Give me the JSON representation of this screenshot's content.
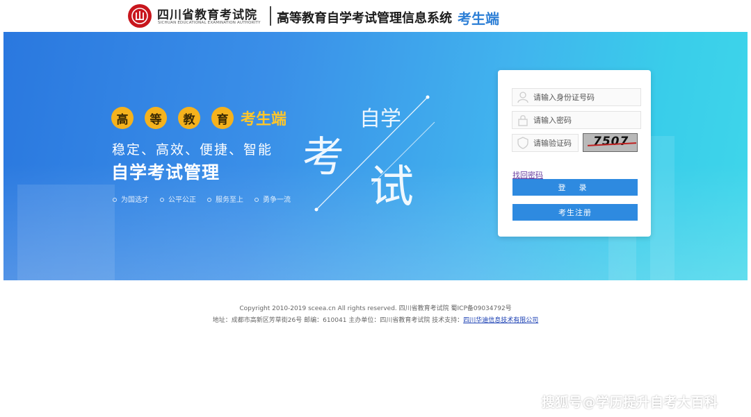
{
  "header": {
    "org_name_cn": "四川省教育考试院",
    "org_name_en": "SICHUAN EDUCATIONAL EXAMINATION AUTHORITY",
    "system_name": "高等教育自学考试管理信息系统",
    "system_role": "考生端",
    "logo_icon": "seal-logo-icon"
  },
  "banner": {
    "badges": [
      "高",
      "等",
      "教",
      "育"
    ],
    "badge_role": "考生端",
    "slogan": "稳定、高效、便捷、智能",
    "headline": "自学考试管理",
    "values": [
      "为国选才",
      "公平公正",
      "服务至上",
      "勇争一流"
    ],
    "art": {
      "line1": "自学",
      "line2": "考",
      "line3": "试"
    }
  },
  "login": {
    "id_placeholder": "请输入身份证号码",
    "password_placeholder": "请输入密码",
    "captcha_placeholder": "请输验证码",
    "captcha_text": "7507",
    "forgot_label": "找回密码",
    "login_label": "登 录",
    "register_label": "考生注册"
  },
  "footer": {
    "copyright": "Copyright 2010-2019 sceea.cn All rights reserved. 四川省教育考试院 蜀ICP备09034792号",
    "address": "地址：成都市高新区芳草街26号 邮编：610041 主办单位：四川省教育考试院 技术支持：",
    "tech_support_link": "四川华迪信息技术有限公司"
  },
  "watermark": "搜狐号@学历提升自考大百科",
  "colors": {
    "brand_red": "#c8161d",
    "accent_blue": "#2e8ae0",
    "badge_gold": "#f5b21d",
    "banner_start": "#2a78df",
    "banner_end": "#3fd6ea"
  }
}
